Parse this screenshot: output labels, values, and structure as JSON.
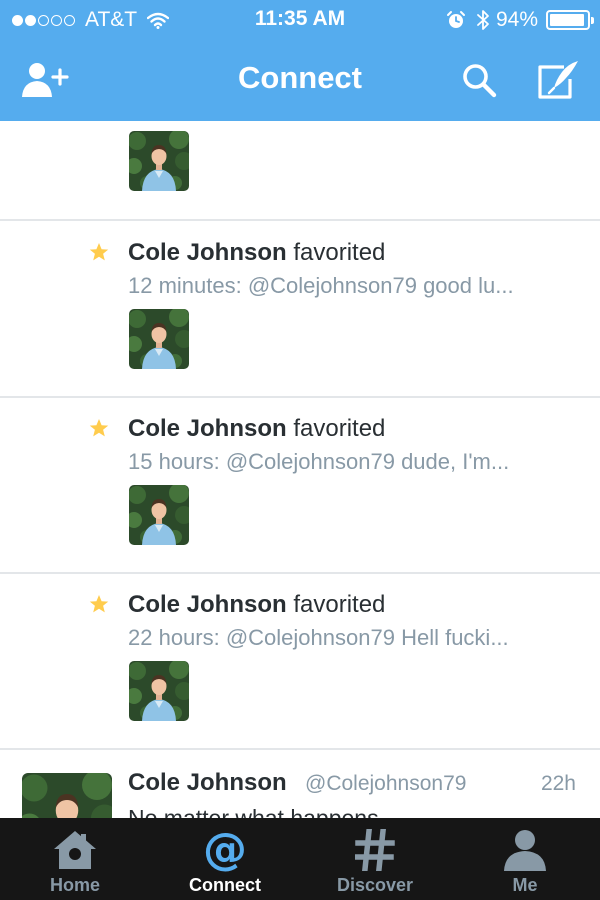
{
  "colors": {
    "header": "#55acee",
    "tabbar": "#161616",
    "star": "#ffcc4d",
    "accent": "#55acee",
    "muted": "#8899a6",
    "text": "#292f33"
  },
  "status_bar": {
    "carrier": "AT&T",
    "time": "11:35 AM",
    "battery": "94%",
    "battery_level": 0.94,
    "signal_bars": 2,
    "icons": [
      "wifi-icon",
      "alarm-icon",
      "bluetooth-icon"
    ]
  },
  "nav": {
    "title": "Connect",
    "left_icon": "add-user-icon",
    "right_icons": [
      "search-icon",
      "compose-icon"
    ]
  },
  "feed": {
    "activities": [
      {
        "who": "",
        "action": "",
        "summary": ""
      },
      {
        "who": "Cole Johnson",
        "action": "favorited",
        "summary": "12 minutes: @Colejohnson79 good lu..."
      },
      {
        "who": "Cole Johnson",
        "action": "favorited",
        "summary": "15 hours: @Colejohnson79 dude, I'm..."
      },
      {
        "who": "Cole Johnson",
        "action": "favorited",
        "summary": "22 hours: @Colejohnson79 Hell fucki..."
      }
    ],
    "tweet": {
      "name": "Cole Johnson",
      "handle": "@Colejohnson79",
      "time": "22h",
      "text": "No matter what happens"
    }
  },
  "tabs": [
    {
      "label": "Home",
      "icon": "home-icon",
      "active": false
    },
    {
      "label": "Connect",
      "icon": "at-icon",
      "active": true
    },
    {
      "label": "Discover",
      "icon": "hashtag-icon",
      "active": false
    },
    {
      "label": "Me",
      "icon": "person-icon",
      "active": false
    }
  ]
}
